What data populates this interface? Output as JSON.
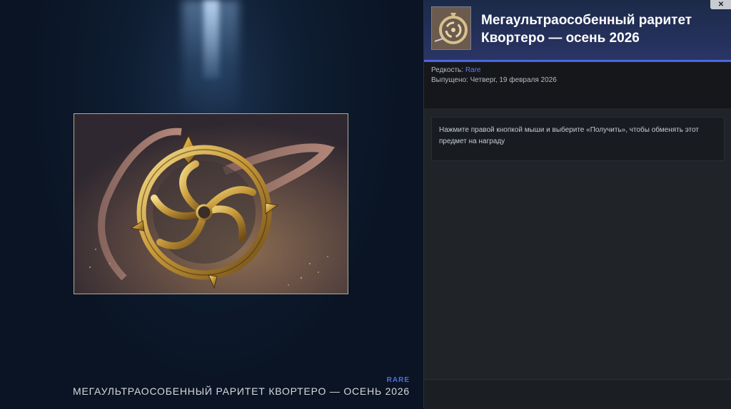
{
  "window": {
    "close_label": "✕",
    "close_icon": "close-icon"
  },
  "showcase": {
    "rarity": "RARE",
    "item_name": "МЕГАУЛЬТРАОСОБЕННЫЙ РАРИТЕТ КВОРТЕРО — ОСЕНЬ 2026",
    "image_icon": "golden-pendant-image"
  },
  "details": {
    "title": "Мегаультраособенный раритет Квортеро — осень 2026",
    "rarity_label": "Редкость:",
    "rarity_value": "Rare",
    "released_label": "Выпущено:",
    "released_value": "Четверг, 19 февраля 2026",
    "description": "Нажмите правой кнопкой мыши и выберите «Получить», чтобы обменять этот предмет на награду",
    "thumbnail_icon": "pendant-thumbnail"
  },
  "colors": {
    "accent": "#4b66e0",
    "rarity": "#5b7cff",
    "panel": "#1d2126",
    "background": "#0b1320"
  }
}
